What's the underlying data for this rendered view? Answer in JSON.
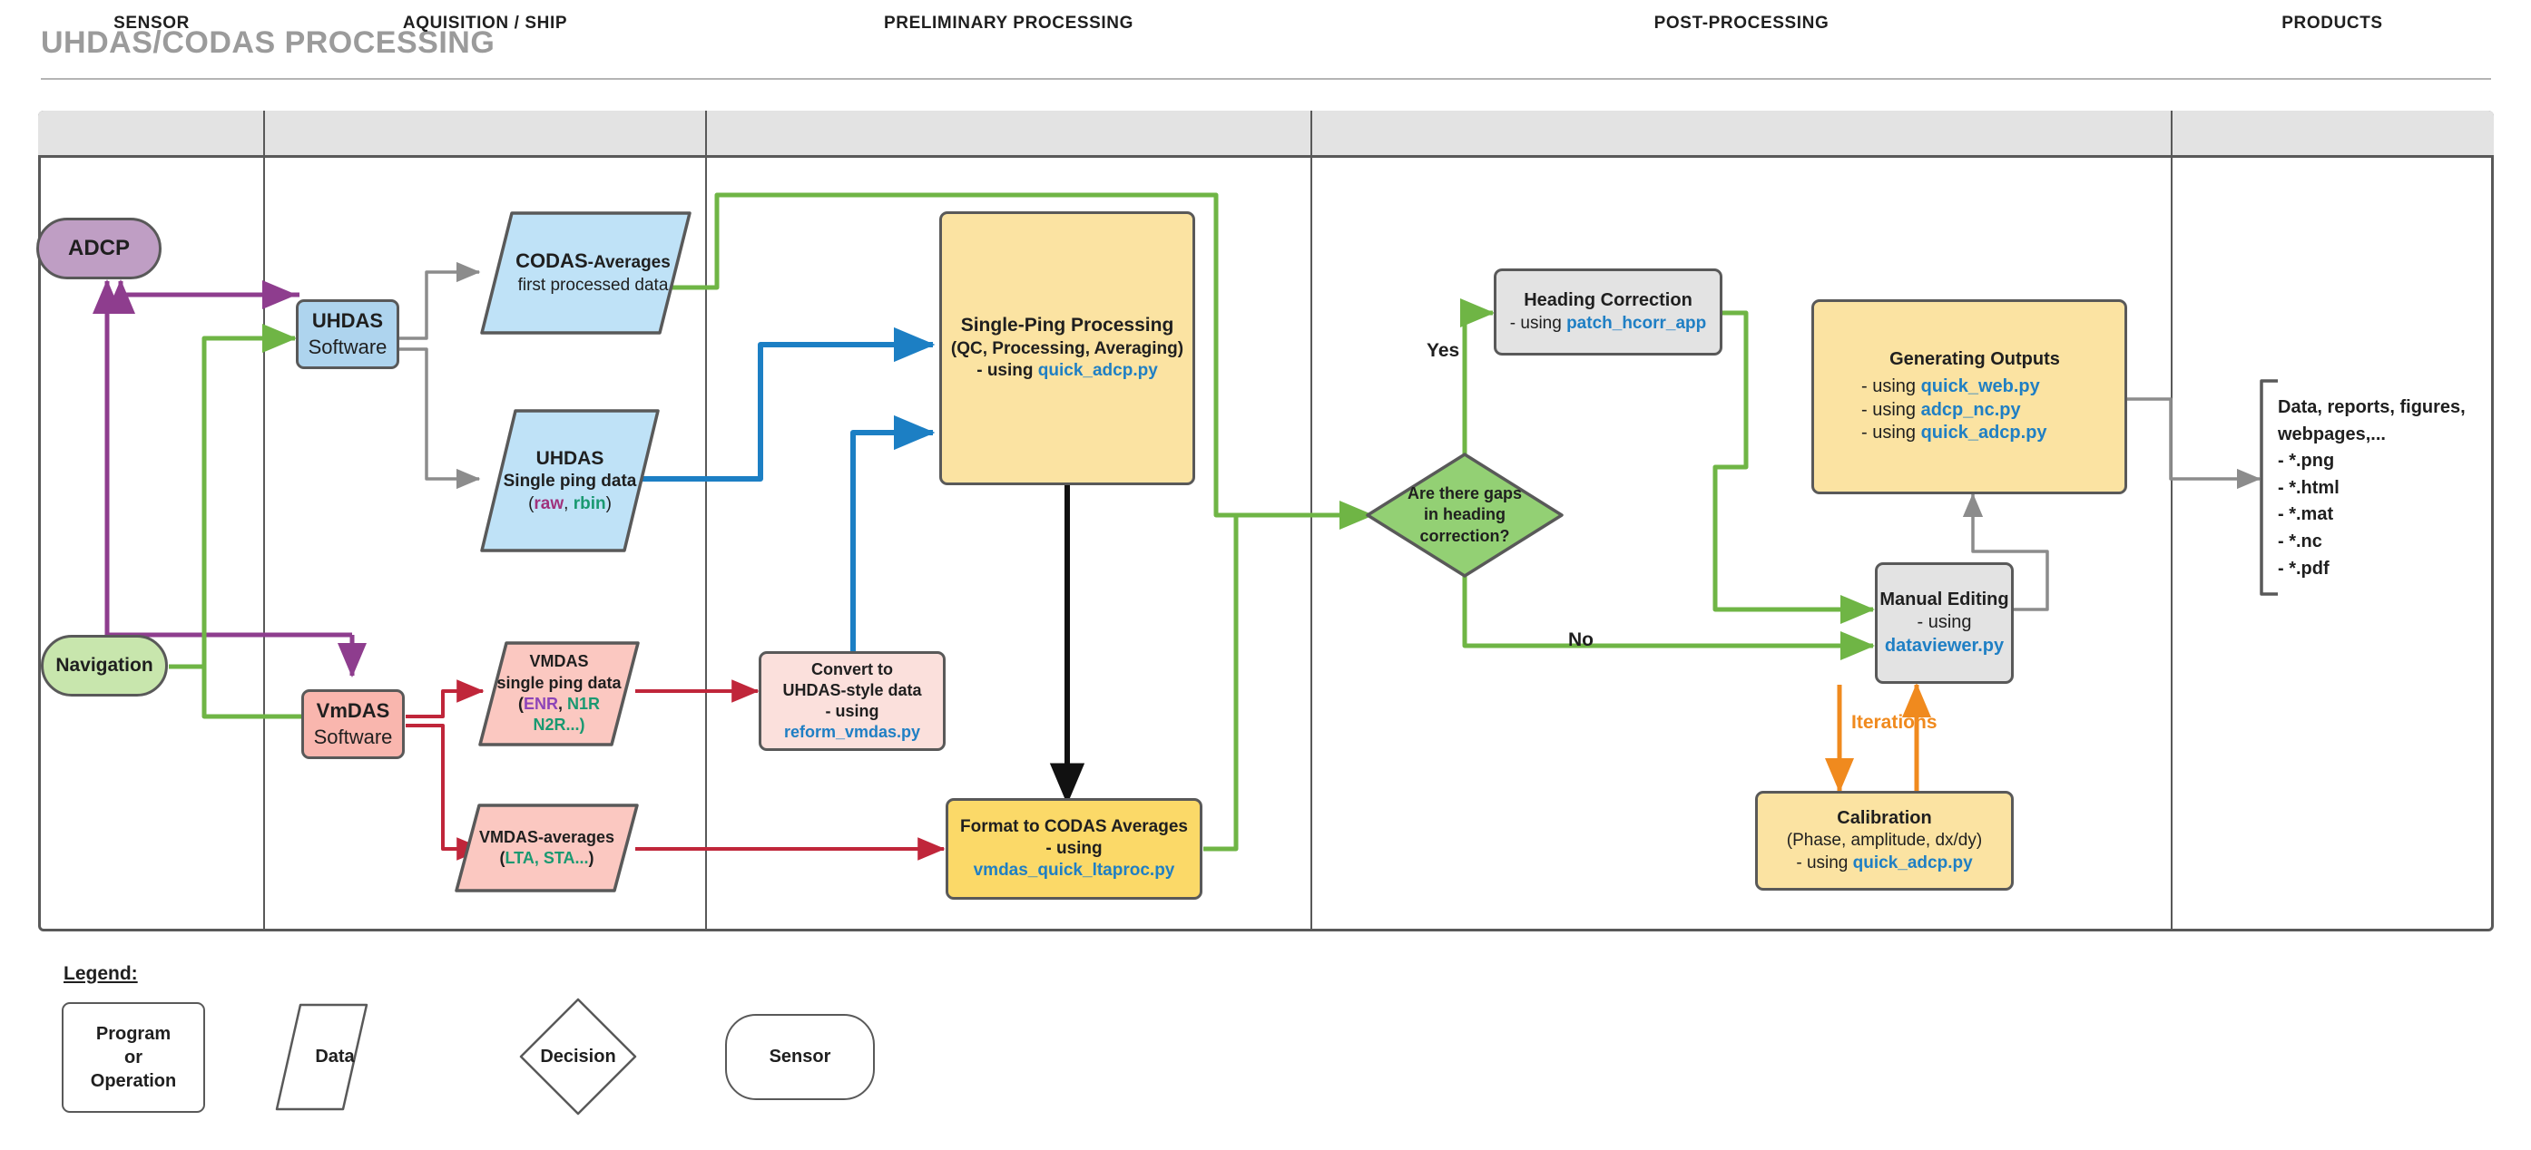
{
  "page": {
    "title": "UHDAS/CODAS PROCESSING"
  },
  "lanes": [
    {
      "id": "sensor",
      "label": "SENSOR"
    },
    {
      "id": "acquisition",
      "label": "AQUISITION / SHIP"
    },
    {
      "id": "preliminary",
      "label": "PRELIMINARY PROCESSING"
    },
    {
      "id": "post",
      "label": "POST-PROCESSING"
    },
    {
      "id": "products",
      "label": "PRODUCTS"
    }
  ],
  "nodes": {
    "adcp": {
      "label": "ADCP",
      "color": "#bf9ec4"
    },
    "navigation": {
      "label": "Navigation",
      "color": "#c8e6ad"
    },
    "uhdas_software": {
      "line1": "UHDAS",
      "line2": "Software",
      "color": "#aed4ee"
    },
    "vmdas_software": {
      "line1": "VmDAS",
      "line2": "Software",
      "color": "#f9b6ae"
    },
    "codas_averages": {
      "title_strong": "CODAS",
      "title_rest": "-Averages",
      "sub": "first processed data",
      "color": "#bfe2f7"
    },
    "uhdas_singleping": {
      "line1": "UHDAS",
      "line2": "Single ping data",
      "paren_open": "(",
      "tag1": "raw",
      "comma": ", ",
      "tag2": "rbin",
      "paren_close": ")",
      "color": "#bfe2f7",
      "tag1_color": "#a0327c",
      "tag2_color": "#1a9971"
    },
    "vmdas_singleping": {
      "line1": "VMDAS",
      "line2": "single ping data",
      "line3_open": "(",
      "tag1": "ENR",
      "tag2": "N1R",
      "line4": "N2R...)",
      "color": "#fbc8c1",
      "tag1_color": "#8d44b8",
      "tag2_color": "#1a9971"
    },
    "vmdas_averages": {
      "line1": "VMDAS-averages",
      "line2_open": "(",
      "tag1": "LTA, STA...",
      "line2_close": ")",
      "color": "#fbc8c1",
      "tag1_color": "#1a9971"
    },
    "single_ping_processing": {
      "line1": "Single-Ping Processing",
      "line2": "(QC, Processing, Averaging)",
      "line3_prefix": "- using ",
      "line3_code": "quick_adcp.py",
      "color": "#fbe3a2"
    },
    "convert": {
      "line1": "Convert to",
      "line2": "UHDAS-style data",
      "line3": "- using",
      "line4_code": "reform_vmdas.py",
      "color": "#fbe0dc"
    },
    "format_codas": {
      "line1": "Format to CODAS Averages",
      "line2": "- using",
      "line3_code": "vmdas_quick_ltaproc.py",
      "color": "#fbd968"
    },
    "heading_correction": {
      "line1": "Heading Correction",
      "line2_prefix": "- using ",
      "line2_code": "patch_hcorr_app",
      "color": "#e3e3e3"
    },
    "gaps_decision": {
      "line1": "Are there gaps",
      "line2": "in heading",
      "line3": "correction?",
      "color": "#93d074"
    },
    "manual_editing": {
      "line1": "Manual Editing",
      "line2_prefix": "- using ",
      "line2_code": "dataviewer.py",
      "color": "#e3e3e3"
    },
    "calibration": {
      "line1": "Calibration",
      "line2": "(Phase, amplitude, dx/dy)",
      "line3_prefix": "- using ",
      "line3_code": "quick_adcp.py",
      "color": "#fbe3a2"
    },
    "generating_outputs": {
      "line1": "Generating Outputs",
      "line2_prefix": "- using ",
      "line2_code": "quick_web.py",
      "line3_prefix": "- using ",
      "line3_code": "adcp_nc.py",
      "line4_prefix": "- using ",
      "line4_code": "quick_adcp.py",
      "color": "#fbe3a2"
    }
  },
  "products": {
    "header_line1": "Data, reports, figures,",
    "header_line2": "webpages,...",
    "items": [
      "- *.png",
      "- *.html",
      "- *.mat",
      "- *.nc",
      "- *.pdf"
    ]
  },
  "edge_labels": {
    "yes": "Yes",
    "no": "No",
    "iterations": "Iterations"
  },
  "legend": {
    "title": "Legend:",
    "items": [
      {
        "id": "program",
        "line1": "Program",
        "line2": "or",
        "line3": "Operation",
        "shape": "rounded-rect"
      },
      {
        "id": "data",
        "line1": "Data",
        "shape": "parallelogram"
      },
      {
        "id": "decision",
        "line1": "Decision",
        "shape": "diamond"
      },
      {
        "id": "sensor",
        "line1": "Sensor",
        "shape": "stadium"
      }
    ]
  },
  "colors": {
    "edge_purple": "#8e3d8e",
    "edge_green": "#6fb545",
    "edge_blue": "#1c7fc4",
    "edge_red": "#c0263a",
    "edge_gray": "#8c8c8c",
    "edge_black": "#111111",
    "edge_orange": "#f08a1e",
    "border_gray": "#595959",
    "code_blue": "#1f7fc4"
  }
}
